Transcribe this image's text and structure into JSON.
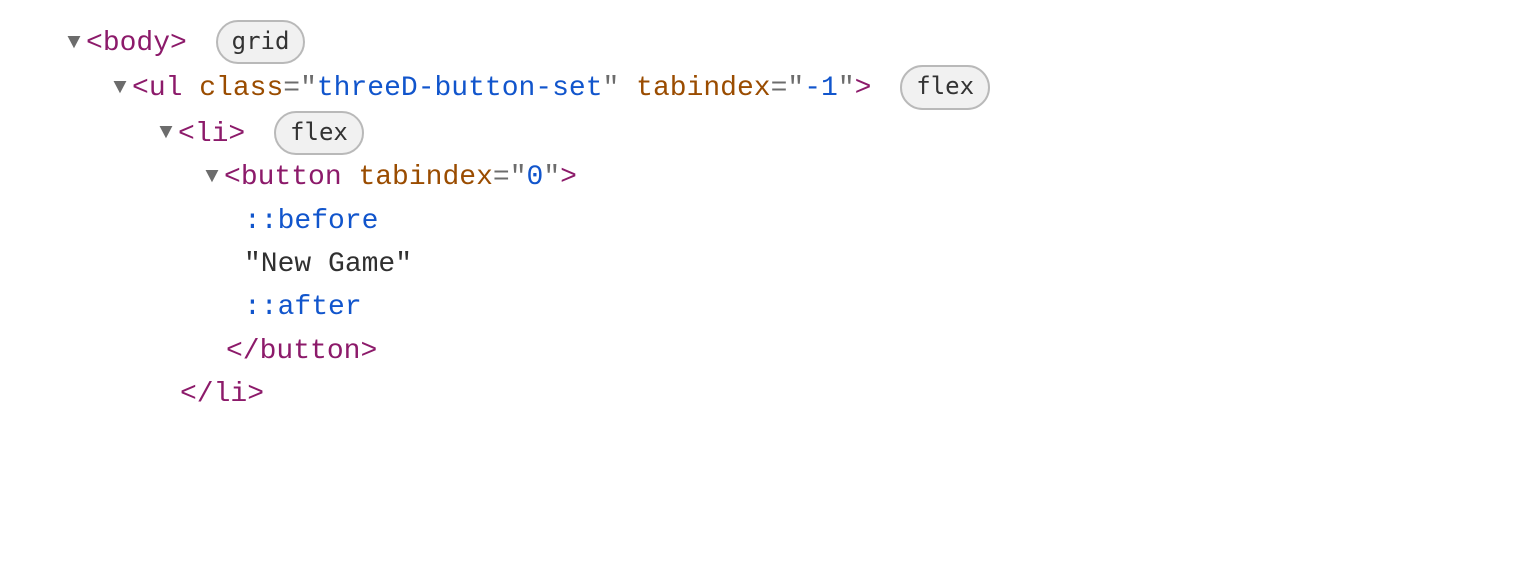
{
  "lines": {
    "l0": {
      "tag": "body",
      "badge": "grid"
    },
    "l1": {
      "tag": "ul",
      "attr1_name": "class",
      "attr1_val": "threeD-button-set",
      "attr2_name": "tabindex",
      "attr2_val": "-1",
      "badge": "flex"
    },
    "l2": {
      "tag": "li",
      "badge": "flex"
    },
    "l3": {
      "tag": "button",
      "attr1_name": "tabindex",
      "attr1_val": "0"
    },
    "l4": {
      "pseudo": "::before"
    },
    "l5": {
      "text": "\"New Game\""
    },
    "l6": {
      "pseudo": "::after"
    },
    "l7": {
      "close": "button"
    },
    "l8": {
      "close": "li"
    }
  }
}
